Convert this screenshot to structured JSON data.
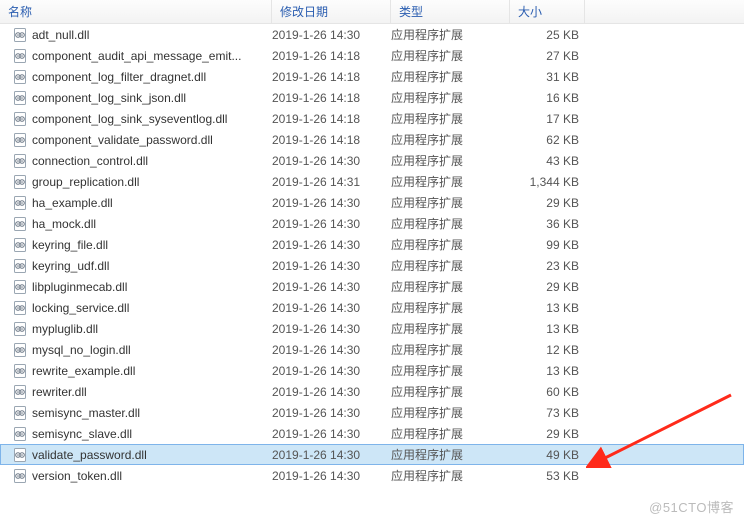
{
  "headers": {
    "name": "名称",
    "modified": "修改日期",
    "type": "类型",
    "size": "大小"
  },
  "file_type_label": "应用程序扩展",
  "files": [
    {
      "name": "adt_null.dll",
      "modified": "2019-1-26 14:30",
      "size": "25 KB",
      "selected": false
    },
    {
      "name": "component_audit_api_message_emit...",
      "modified": "2019-1-26 14:18",
      "size": "27 KB",
      "selected": false
    },
    {
      "name": "component_log_filter_dragnet.dll",
      "modified": "2019-1-26 14:18",
      "size": "31 KB",
      "selected": false
    },
    {
      "name": "component_log_sink_json.dll",
      "modified": "2019-1-26 14:18",
      "size": "16 KB",
      "selected": false
    },
    {
      "name": "component_log_sink_syseventlog.dll",
      "modified": "2019-1-26 14:18",
      "size": "17 KB",
      "selected": false
    },
    {
      "name": "component_validate_password.dll",
      "modified": "2019-1-26 14:18",
      "size": "62 KB",
      "selected": false
    },
    {
      "name": "connection_control.dll",
      "modified": "2019-1-26 14:30",
      "size": "43 KB",
      "selected": false
    },
    {
      "name": "group_replication.dll",
      "modified": "2019-1-26 14:31",
      "size": "1,344 KB",
      "selected": false
    },
    {
      "name": "ha_example.dll",
      "modified": "2019-1-26 14:30",
      "size": "29 KB",
      "selected": false
    },
    {
      "name": "ha_mock.dll",
      "modified": "2019-1-26 14:30",
      "size": "36 KB",
      "selected": false
    },
    {
      "name": "keyring_file.dll",
      "modified": "2019-1-26 14:30",
      "size": "99 KB",
      "selected": false
    },
    {
      "name": "keyring_udf.dll",
      "modified": "2019-1-26 14:30",
      "size": "23 KB",
      "selected": false
    },
    {
      "name": "libpluginmecab.dll",
      "modified": "2019-1-26 14:30",
      "size": "29 KB",
      "selected": false
    },
    {
      "name": "locking_service.dll",
      "modified": "2019-1-26 14:30",
      "size": "13 KB",
      "selected": false
    },
    {
      "name": "mypluglib.dll",
      "modified": "2019-1-26 14:30",
      "size": "13 KB",
      "selected": false
    },
    {
      "name": "mysql_no_login.dll",
      "modified": "2019-1-26 14:30",
      "size": "12 KB",
      "selected": false
    },
    {
      "name": "rewrite_example.dll",
      "modified": "2019-1-26 14:30",
      "size": "13 KB",
      "selected": false
    },
    {
      "name": "rewriter.dll",
      "modified": "2019-1-26 14:30",
      "size": "60 KB",
      "selected": false
    },
    {
      "name": "semisync_master.dll",
      "modified": "2019-1-26 14:30",
      "size": "73 KB",
      "selected": false
    },
    {
      "name": "semisync_slave.dll",
      "modified": "2019-1-26 14:30",
      "size": "29 KB",
      "selected": false
    },
    {
      "name": "validate_password.dll",
      "modified": "2019-1-26 14:30",
      "size": "49 KB",
      "selected": true
    },
    {
      "name": "version_token.dll",
      "modified": "2019-1-26 14:30",
      "size": "53 KB",
      "selected": false
    }
  ],
  "watermark": "@51CTO博客"
}
